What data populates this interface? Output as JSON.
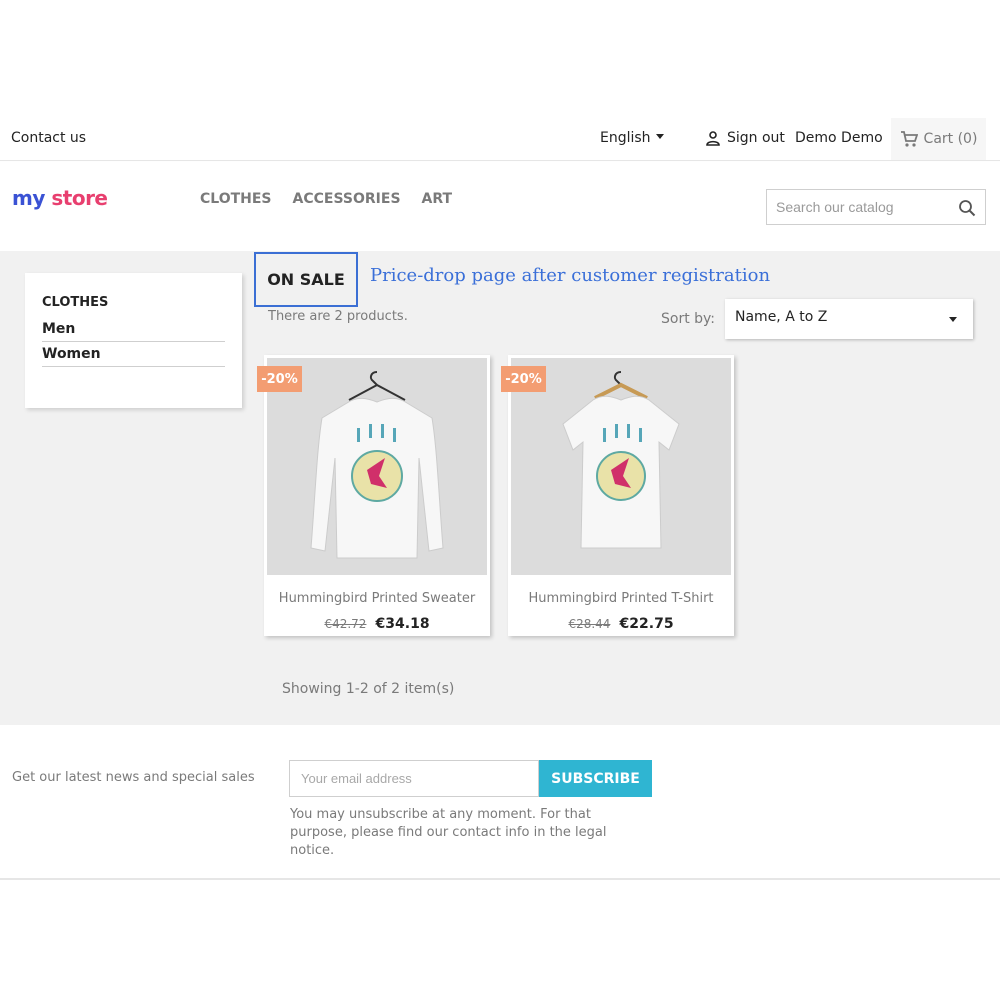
{
  "topbar": {
    "contact": "Contact us",
    "language": "English",
    "sign_out": "Sign out",
    "user_name": "Demo Demo",
    "cart": "Cart (0)"
  },
  "header": {
    "logo": {
      "part1": "my",
      "part2": "store"
    },
    "nav": [
      "CLOTHES",
      "ACCESSORIES",
      "ART"
    ],
    "search_placeholder": "Search our catalog"
  },
  "sidebar": {
    "title": "CLOTHES",
    "items": [
      "Men",
      "Women"
    ]
  },
  "listing": {
    "heading": "ON SALE",
    "annotation": "Price-drop page after customer registration",
    "count_text": "There are 2 products.",
    "sort_label": "Sort by:",
    "sort_value": "Name, A to Z",
    "showing": "Showing 1-2 of 2 item(s)"
  },
  "products": [
    {
      "name": "Hummingbird Printed Sweater",
      "old_price": "€42.72",
      "price": "€34.18",
      "discount": "-20%",
      "image": "long-sleeve-sweater-image"
    },
    {
      "name": "Hummingbird Printed T-Shirt",
      "old_price": "€28.44",
      "price": "€22.75",
      "discount": "-20%",
      "image": "tshirt-image"
    }
  ],
  "newsletter": {
    "label": "Get our latest news and special sales",
    "email_placeholder": "Your email address",
    "subscribe": "SUBSCRIBE",
    "notice": "You may unsubscribe at any moment. For that purpose, please find our contact info in the legal notice."
  },
  "colors": {
    "accent": "#2fb5d2",
    "discount_badge": "#f39d72",
    "annotation_box": "#3b6fd4",
    "annotation_text": "#3a6fd8",
    "logo_my": "#3a52d4",
    "logo_store": "#e83f6f"
  }
}
